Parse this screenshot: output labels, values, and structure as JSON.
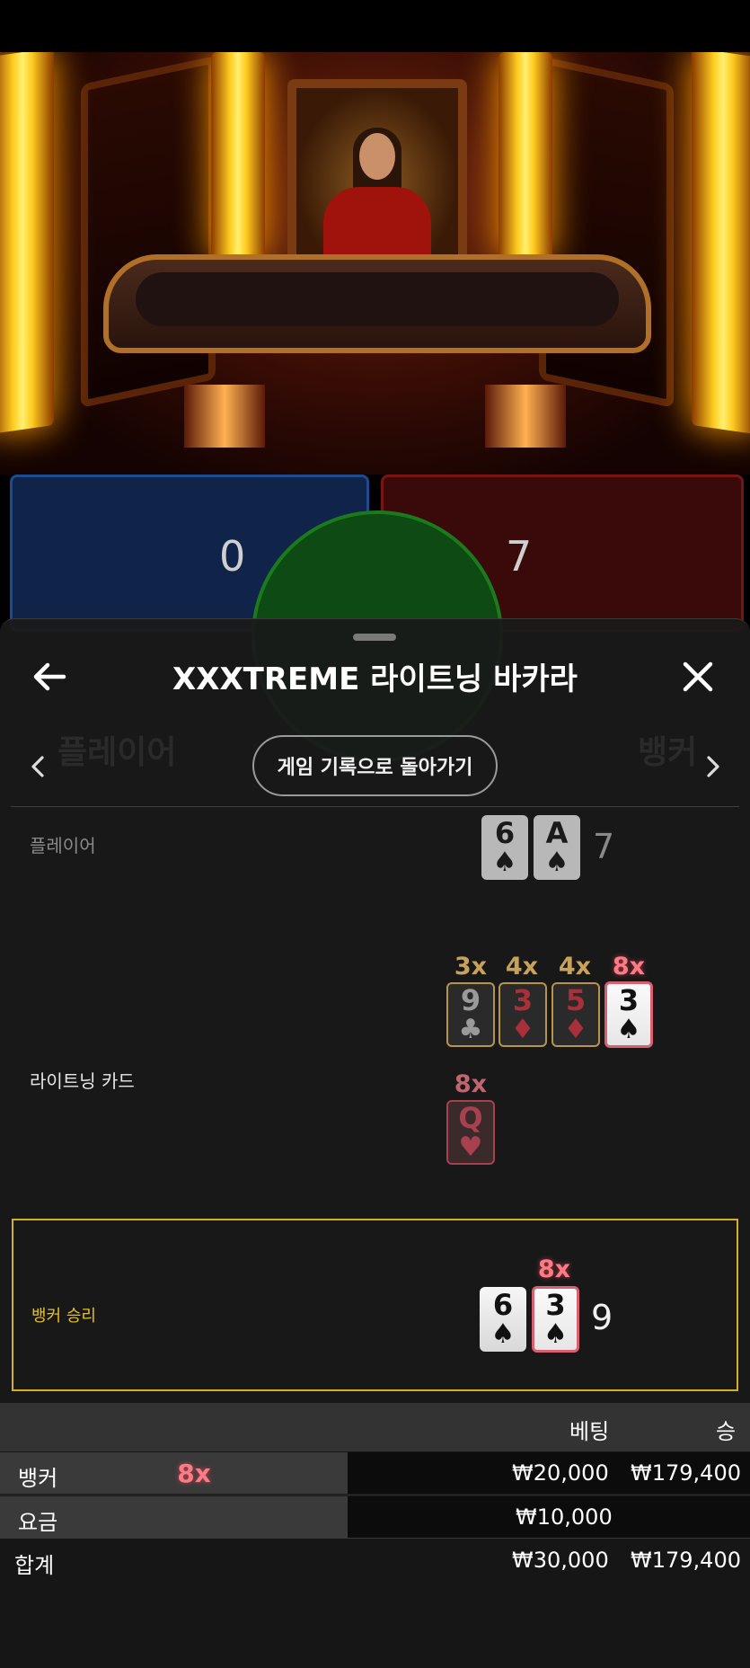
{
  "score": {
    "player": "0",
    "banker": "7"
  },
  "sheet": {
    "title": "XXXTREME 라이트닝 바카라",
    "history_button": "게임 기록으로 돌아가기",
    "background_labels": {
      "player": "플레이어",
      "banker": "뱅커"
    }
  },
  "rows": {
    "player": {
      "label": "플레이어",
      "cards": [
        {
          "rank": "6",
          "suit": "♠"
        },
        {
          "rank": "A",
          "suit": "♠"
        }
      ],
      "total": "7"
    },
    "lightning": {
      "label": "라이트닝 카드",
      "cards": [
        {
          "rank": "9",
          "suit": "♣",
          "multiplier": "3x"
        },
        {
          "rank": "3",
          "suit": "♦",
          "multiplier": "4x"
        },
        {
          "rank": "5",
          "suit": "♦",
          "multiplier": "4x"
        },
        {
          "rank": "3",
          "suit": "♠",
          "multiplier": "8x"
        },
        {
          "rank": "Q",
          "suit": "♥",
          "multiplier": "8x"
        }
      ]
    },
    "banker": {
      "label": "뱅커 승리",
      "cards": [
        {
          "rank": "6",
          "suit": "♠"
        },
        {
          "rank": "3",
          "suit": "♠",
          "multiplier": "8x"
        }
      ],
      "total": "9"
    }
  },
  "bets": {
    "headers": {
      "bet": "베팅",
      "win": "승"
    },
    "rows": [
      {
        "name": "뱅커",
        "multiplier": "8x",
        "bet": "₩20,000",
        "win": "₩179,400"
      },
      {
        "name": "요금",
        "bet": "₩10,000",
        "win": ""
      }
    ],
    "total": {
      "name": "합계",
      "bet": "₩30,000",
      "win": "₩179,400"
    }
  },
  "colors": {
    "accent_gold": "#d4b020",
    "multiplier_pink": "#ff7a85",
    "player_blue": "#1e4a8e",
    "banker_red": "#7a1414"
  }
}
